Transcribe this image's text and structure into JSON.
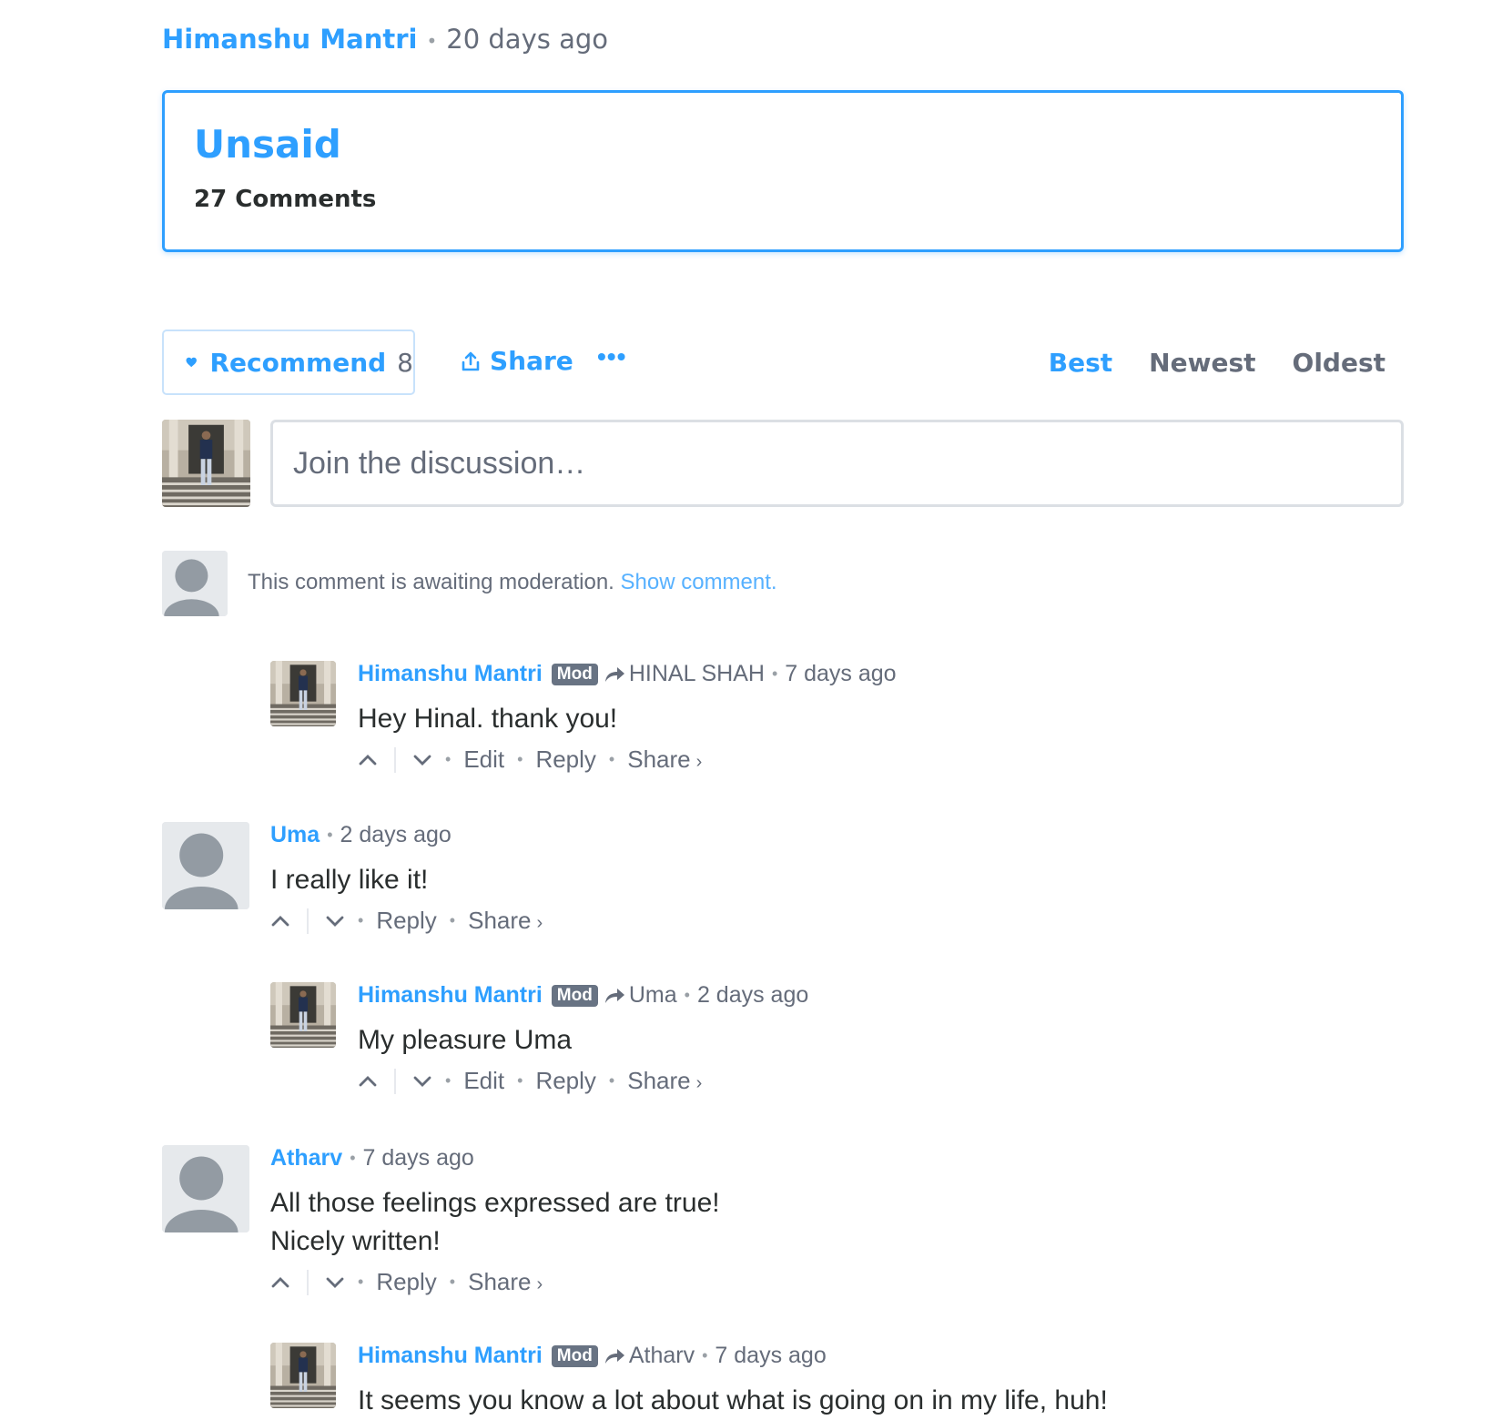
{
  "byline": {
    "author": "Himanshu Mantri",
    "time": "20 days ago"
  },
  "thread": {
    "title": "Unsaid",
    "comment_count": "27 Comments"
  },
  "toolbar": {
    "recommend_label": "Recommend",
    "recommend_count": "8",
    "share_label": "Share",
    "more_label": "•••",
    "sort": {
      "best": "Best",
      "newest": "Newest",
      "oldest": "Oldest",
      "active": "Best"
    }
  },
  "composer": {
    "placeholder": "Join the discussion…"
  },
  "pending": {
    "text": "This comment is awaiting moderation.",
    "link": "Show comment."
  },
  "labels": {
    "mod": "Mod",
    "edit": "Edit",
    "reply": "Reply",
    "share": "Share",
    "chevron": "›"
  },
  "comments": [
    {
      "author": "Himanshu Mantri",
      "parent": "HINAL SHAH",
      "time": "7 days ago",
      "body": "Hey Hinal. thank you!"
    },
    {
      "author": "Uma",
      "time": "2 days ago",
      "body": "I really like it!"
    },
    {
      "author": "Himanshu Mantri",
      "parent": "Uma",
      "time": "2 days ago",
      "body": "My pleasure Uma"
    },
    {
      "author": "Atharv",
      "time": "7 days ago",
      "body_line1": "All those feelings expressed are true!",
      "body_line2": "Nicely written!"
    },
    {
      "author": "Himanshu Mantri",
      "parent": "Atharv",
      "time": "7 days ago",
      "body": "It seems you know a lot about what is going on in my life, huh!"
    }
  ]
}
